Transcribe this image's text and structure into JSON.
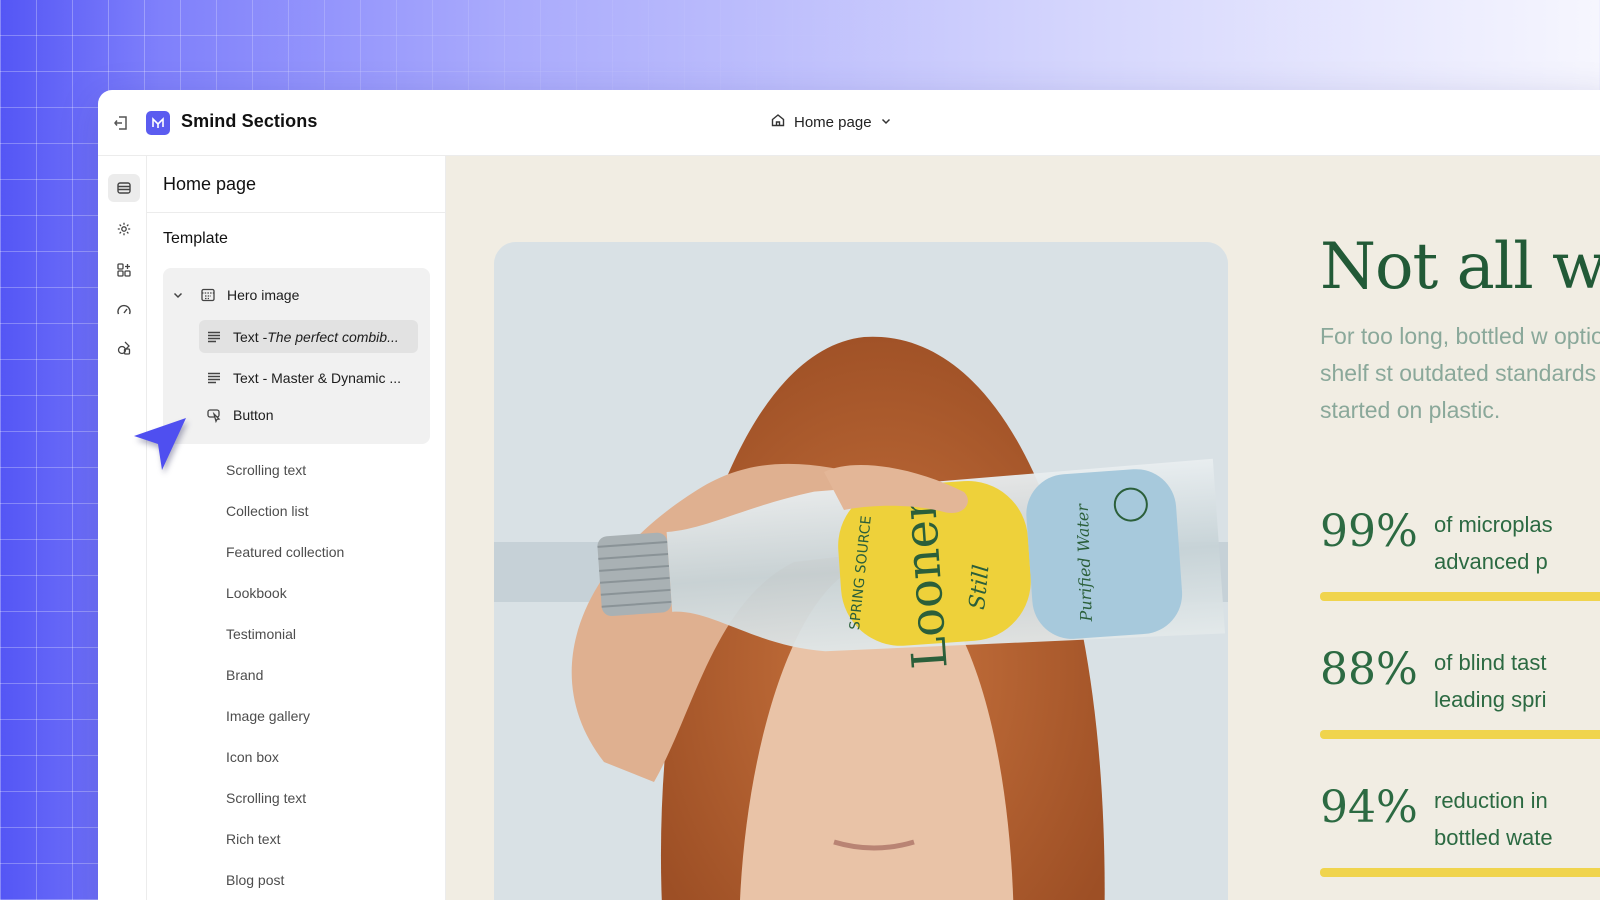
{
  "app": {
    "title": "Smind Sections",
    "page_selector": "Home page"
  },
  "panel": {
    "header": "Home page",
    "template_label": "Template",
    "hero": {
      "label": "Hero image",
      "children": [
        {
          "prefix": "Text - ",
          "italic": "The perfect combib...",
          "selected": true
        },
        {
          "prefix": "Text - Master & Dynamic  ...",
          "italic": ""
        },
        {
          "prefix": "Button",
          "italic": ""
        }
      ]
    },
    "sections": [
      "Scrolling text",
      "Collection list",
      "Featured collection",
      "Lookbook",
      "Testimonial",
      "Brand",
      "Image gallery",
      "Icon box",
      "Scrolling text",
      "Rich text",
      "Blog post"
    ]
  },
  "preview": {
    "headline": "Not all w",
    "intro": "For too long, bottled w options on the shelf st outdated standards th us started on plastic.",
    "stats": [
      {
        "value": "99%",
        "text": "of microplas\nadvanced p"
      },
      {
        "value": "88%",
        "text": "of blind tast\nleading spri"
      },
      {
        "value": "94%",
        "text": "reduction in\nbottled wate"
      }
    ],
    "bottle_label": {
      "brand": "Loonen",
      "variant": "Still",
      "side": "SPRING SOURCE",
      "note": "Purified Water"
    }
  },
  "colors": {
    "accent": "#5b5cf0",
    "headline": "#225a37",
    "stat_bar": "#f0d44d",
    "preview_bg": "#f1ede3"
  }
}
